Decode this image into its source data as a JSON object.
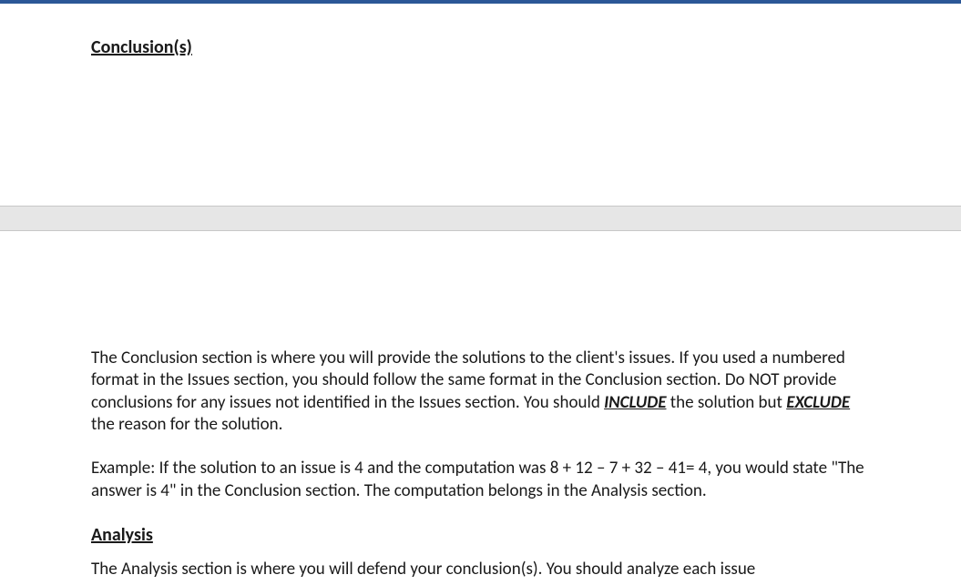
{
  "sections": {
    "conclusion": {
      "heading": "Conclusion(s)",
      "p1_a": "The Conclusion section is where you will provide the solutions to the client's issues.  If you used a numbered format in the Issues section, you should follow the same format in the Conclusion section.  Do NOT provide conclusions for any issues not identified in the Issues section.  You should ",
      "p1_emph1": "INCLUDE",
      "p1_b": " the solution but ",
      "p1_emph2": "EXCLUDE",
      "p1_c": " the reason for the solution.",
      "p2": "Example: If the solution to an issue is 4 and the computation was 8 + 12 – 7 + 32 – 41= 4, you would state \"The answer is 4\" in the Conclusion section.  The computation belongs in the Analysis section."
    },
    "analysis": {
      "heading": "Analysis",
      "p1": "The Analysis section is where you will defend your conclusion(s).  You should analyze each issue"
    }
  }
}
